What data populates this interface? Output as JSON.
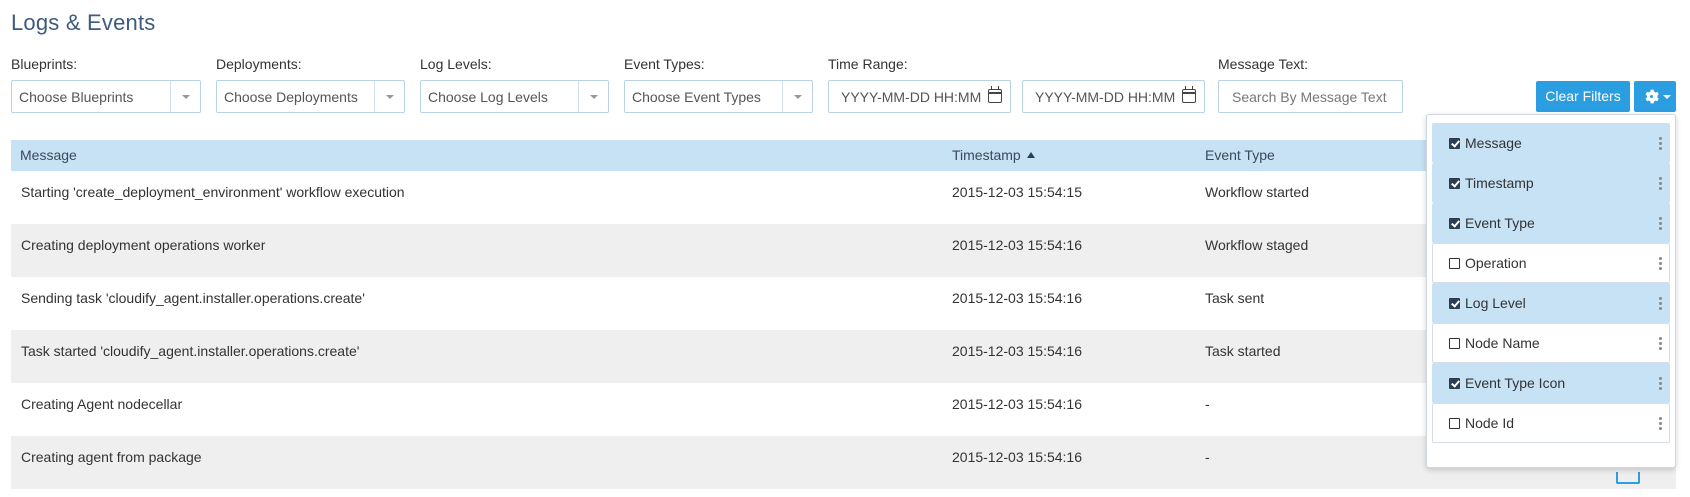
{
  "page": {
    "title": "Logs & Events"
  },
  "filters": {
    "blueprints": {
      "label": "Blueprints:",
      "placeholder": "Choose Blueprints"
    },
    "deployments": {
      "label": "Deployments:",
      "placeholder": "Choose Deployments"
    },
    "log_levels": {
      "label": "Log Levels:",
      "placeholder": "Choose Log Levels"
    },
    "event_types": {
      "label": "Event Types:",
      "placeholder": "Choose Event Types"
    },
    "time_range": {
      "label": "Time Range:",
      "from_placeholder": "YYYY-MM-DD HH:MM",
      "to_placeholder": "YYYY-MM-DD HH:MM"
    },
    "message_text": {
      "label": "Message Text:",
      "placeholder": "Search By Message Text"
    },
    "clear_label": "Clear Filters"
  },
  "table": {
    "columns": [
      "Message",
      "Timestamp",
      "Event Type"
    ],
    "sort": {
      "column": "Timestamp",
      "direction": "asc"
    },
    "rows": [
      {
        "message": "Starting 'create_deployment_environment' workflow execution",
        "timestamp": "2015-12-03 15:54:15",
        "event_type": "Workflow started"
      },
      {
        "message": "Creating deployment operations worker",
        "timestamp": "2015-12-03 15:54:16",
        "event_type": "Workflow staged"
      },
      {
        "message": "Sending task 'cloudify_agent.installer.operations.create'",
        "timestamp": "2015-12-03 15:54:16",
        "event_type": "Task sent"
      },
      {
        "message": "Task started 'cloudify_agent.installer.operations.create'",
        "timestamp": "2015-12-03 15:54:16",
        "event_type": "Task started"
      },
      {
        "message": "Creating Agent nodecellar",
        "timestamp": "2015-12-03 15:54:16",
        "event_type": "-"
      },
      {
        "message": "Creating agent from package",
        "timestamp": "2015-12-03 15:54:16",
        "event_type": "-"
      }
    ]
  },
  "column_picker": {
    "items": [
      {
        "label": "Message",
        "checked": true
      },
      {
        "label": "Timestamp",
        "checked": true
      },
      {
        "label": "Event Type",
        "checked": true
      },
      {
        "label": "Operation",
        "checked": false
      },
      {
        "label": "Log Level",
        "checked": true
      },
      {
        "label": "Node Name",
        "checked": false
      },
      {
        "label": "Event Type Icon",
        "checked": true
      },
      {
        "label": "Node Id",
        "checked": false
      }
    ]
  },
  "colors": {
    "accent": "#2a9ee0",
    "header_bg": "#c7e1f5",
    "title": "#3d5a80",
    "alt_row": "#efefef"
  },
  "icons": {
    "sort": "sort-asc-icon",
    "gear": "gear-icon",
    "calendar": "calendar-icon",
    "grip": "drag-handle-icon",
    "checkbox": "checkbox-icon"
  }
}
